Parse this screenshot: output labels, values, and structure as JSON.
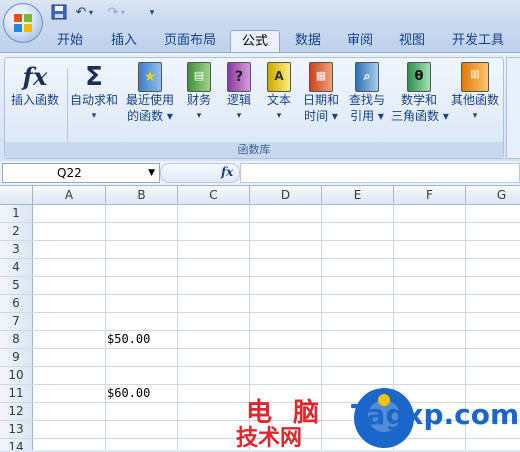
{
  "quick_access": {
    "save_icon": "save-icon",
    "undo_icon": "undo-icon",
    "redo_icon": "redo-icon",
    "customize_icon": "customize-qat-icon"
  },
  "tabs": [
    {
      "label": "开始",
      "active": false
    },
    {
      "label": "插入",
      "active": false
    },
    {
      "label": "页面布局",
      "active": false
    },
    {
      "label": "公式",
      "active": true
    },
    {
      "label": "数据",
      "active": false
    },
    {
      "label": "审阅",
      "active": false
    },
    {
      "label": "视图",
      "active": false
    },
    {
      "label": "开发工具",
      "active": false
    }
  ],
  "ribbon": {
    "group_label": "函数库",
    "buttons": [
      {
        "line1": "插入函数",
        "line2": "",
        "icon": "fx-icon"
      },
      {
        "line1": "自动求和",
        "line2": "▾",
        "icon": "sigma-icon"
      },
      {
        "line1": "最近使用",
        "line2": "的函数 ▾",
        "icon": "recent-book-icon"
      },
      {
        "line1": "财务",
        "line2": "▾",
        "icon": "finance-book-icon"
      },
      {
        "line1": "逻辑",
        "line2": "▾",
        "icon": "logic-book-icon"
      },
      {
        "line1": "文本",
        "line2": "▾",
        "icon": "text-book-icon"
      },
      {
        "line1": "日期和",
        "line2": "时间 ▾",
        "icon": "datetime-book-icon"
      },
      {
        "line1": "查找与",
        "line2": "引用 ▾",
        "icon": "lookup-book-icon"
      },
      {
        "line1": "数学和",
        "line2": "三角函数 ▾",
        "icon": "math-book-icon"
      },
      {
        "line1": "其他函数",
        "line2": "▾",
        "icon": "other-book-icon"
      }
    ]
  },
  "formula_bar": {
    "name_box": "Q22",
    "fx_label": "fx",
    "formula": ""
  },
  "columns": [
    "A",
    "B",
    "C",
    "D",
    "E",
    "F",
    "G"
  ],
  "rows": [
    "1",
    "2",
    "3",
    "4",
    "5",
    "6",
    "7",
    "8",
    "9",
    "10",
    "11",
    "12",
    "13",
    "14"
  ],
  "cells": {
    "B8": "$50.00",
    "B11": "$60.00"
  },
  "watermark": {
    "cn_line1": "电 脑",
    "cn_line2": "技术网",
    "en": "Tagxp.com"
  }
}
